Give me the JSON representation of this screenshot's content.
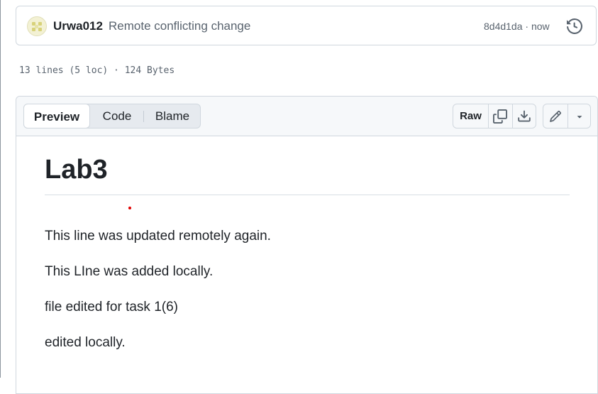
{
  "commit": {
    "author": "Urwa012",
    "message": "Remote conflicting change",
    "meta": "8d4d1da · now",
    "history_icon": "history-icon"
  },
  "file_info": "13 lines (5 loc) · 124 Bytes",
  "tabs": [
    {
      "label": "Preview",
      "active": true
    },
    {
      "label": "Code",
      "active": false
    },
    {
      "label": "Blame",
      "active": false
    }
  ],
  "toolbar": {
    "raw_label": "Raw",
    "copy_icon": "copy-icon",
    "download_icon": "download-icon",
    "edit_icon": "pencil-icon",
    "more_icon": "triangle-down-icon"
  },
  "markdown": {
    "heading": "Lab3",
    "paragraphs": [
      "This line was updated remotely again.",
      "This LIne was added locally.",
      "file edited for task 1(6)",
      "edited locally."
    ]
  }
}
